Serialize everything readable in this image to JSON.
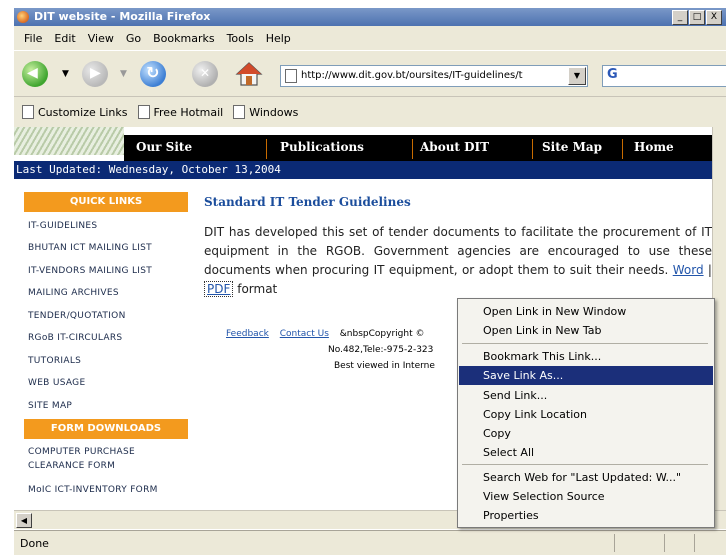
{
  "window": {
    "title": "DIT website - Mozilla Firefox",
    "buttons": [
      "_",
      "□",
      "X"
    ]
  },
  "menubar": [
    "File",
    "Edit",
    "View",
    "Go",
    "Bookmarks",
    "Tools",
    "Help"
  ],
  "toolbar": {
    "url": "http://www.dit.gov.bt/oursites/IT-guidelines/t"
  },
  "bookmarks": [
    "Customize Links",
    "Free Hotmail",
    "Windows"
  ],
  "site": {
    "nav": [
      "Our Site",
      "Publications",
      "About DIT",
      "Site Map",
      "Home"
    ],
    "last_updated": "Last Updated: Wednesday, October 13,2004",
    "quick_links_heading": "QUICK LINKS",
    "quick_links": [
      "IT-GUIDELINES",
      "BHUTAN ICT MAILING LIST",
      "IT-VENDORS MAILING LIST",
      "MAILING ARCHIVES",
      "TENDER/QUOTATION",
      "RGoB IT-CIRCULARS",
      "TUTORIALS",
      "WEB USAGE",
      "SITE MAP"
    ],
    "form_downloads_heading": "FORM DOWNLOADS",
    "form_downloads": [
      "COMPUTER PURCHASE",
      "CLEARANCE FORM",
      "MoIC ICT-INVENTORY FORM"
    ],
    "article_title": "Standard IT Tender Guidelines",
    "article_text": "DIT has developed this set of tender documents to facilitate the procurement of IT equipment in the RGOB. Government agencies are encouraged to use these documents when procuring IT equipment, or adopt them to suit their needs.",
    "word_link": "Word",
    "separator": "|",
    "pdf_link": "PDF",
    "format_suffix": "format",
    "footer": {
      "feedback": "Feedback",
      "contact": "Contact Us",
      "copyright": "&nbspCopyright ©",
      "address": "No.482,Tele:-975-2-323",
      "best_viewed": "Best viewed in Interne"
    }
  },
  "context_menu": [
    "Open Link in New Window",
    "Open Link in New Tab",
    "Bookmark This Link...",
    "Save Link As...",
    "Send Link...",
    "Copy Link Location",
    "Copy",
    "Select All",
    "Search Web for \"Last Updated: W...\"",
    "View Selection Source",
    "Properties"
  ],
  "status": {
    "text": "Done"
  }
}
